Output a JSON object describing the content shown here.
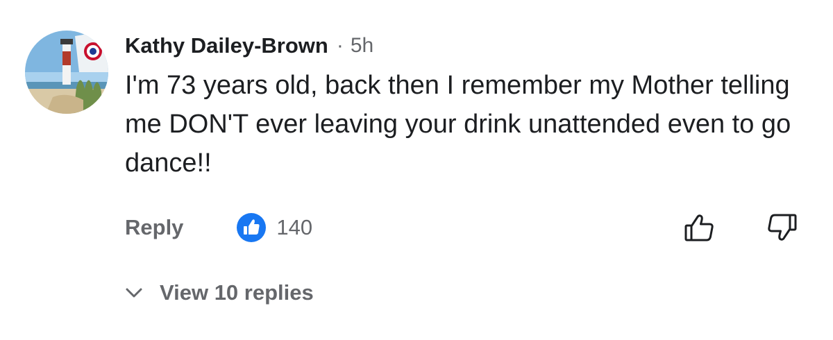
{
  "comment": {
    "author": "Kathy Dailey-Brown",
    "separator": "·",
    "timestamp": "5h",
    "text": "I'm 73 years old, back then I remember my Mother telling me DON'T ever leaving your drink unattended even to go dance!!",
    "reply_label": "Reply",
    "reaction_icon": "thumbs-up-reaction-icon",
    "reaction_count": "140",
    "like_icon": "thumbs-up-outline-icon",
    "dislike_icon": "thumbs-down-outline-icon",
    "view_replies_label": "View 10 replies"
  },
  "colors": {
    "text_primary": "#1c1e21",
    "text_secondary": "#65676b",
    "reaction_blue": "#1877f2"
  }
}
